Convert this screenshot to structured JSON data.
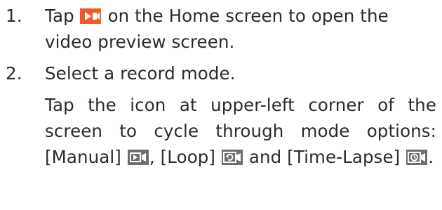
{
  "steps": [
    {
      "number": "1.",
      "before_icon": "Tap",
      "icon": "video-preview-icon",
      "after_icon": "on the Home screen to open the video preview screen."
    },
    {
      "number": "2.",
      "text": "Select a record mode.",
      "instruction_start": "Tap the icon at upper-left corner of the screen to cycle through mode options:",
      "modes": [
        {
          "label": "[Manual]",
          "icon": "manual-mode-icon",
          "suffix": ","
        },
        {
          "label": "[Loop]",
          "icon": "loop-mode-icon",
          "suffix": "and"
        },
        {
          "label": "[Time-Lapse]",
          "icon": "time-lapse-mode-icon",
          "suffix": "."
        }
      ]
    }
  ],
  "colors": {
    "text": "#2b2b2b",
    "orange_icon": "#f05a28",
    "gray_icon": "#6e6e6e"
  }
}
